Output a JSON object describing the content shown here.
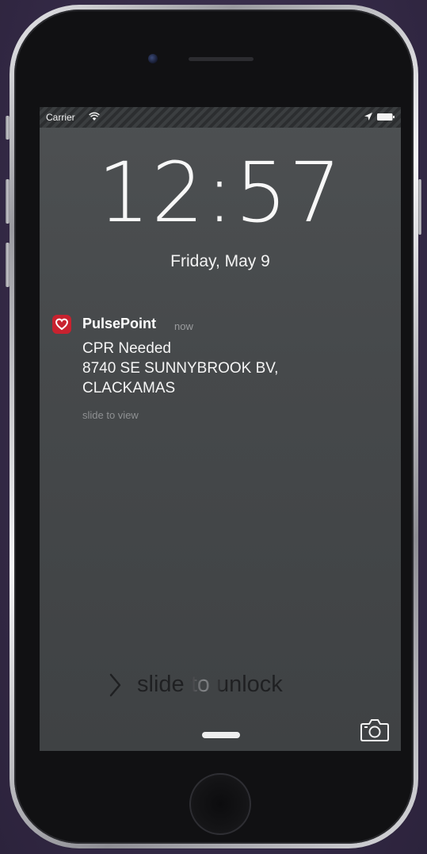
{
  "status_bar": {
    "carrier": "Carrier",
    "wifi_icon": "wifi-icon",
    "location_icon": "location-arrow-icon",
    "battery_icon": "battery-icon"
  },
  "lock_screen": {
    "time": "12:57",
    "date": "Friday, May 9"
  },
  "notification": {
    "app_icon": "pulsepoint-heart-icon",
    "app_name": "PulsePoint",
    "timestamp": "now",
    "lines": [
      "CPR Needed",
      "8740 SE SUNNYBROOK BV,",
      "CLACKAMAS"
    ],
    "action_hint": "slide to view"
  },
  "unlock": {
    "label": "slide to unlock",
    "chevron_icon": "chevron-right-icon"
  },
  "camera_shortcut": {
    "icon": "camera-icon"
  },
  "colors": {
    "app_accent": "#c8222f",
    "background": "#3a2f4c",
    "screen": "#46494b"
  }
}
